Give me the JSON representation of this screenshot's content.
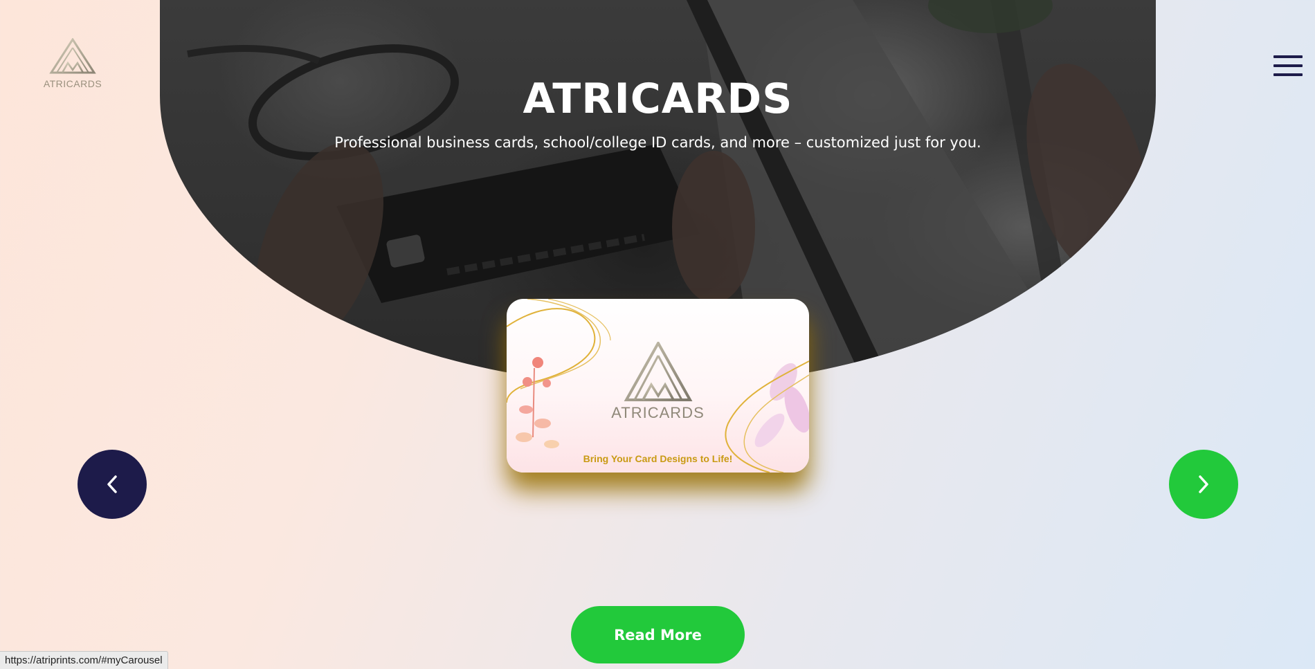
{
  "brand": {
    "logo_text": "ATRICARDS"
  },
  "hero": {
    "title": "ATRICARDS",
    "subtitle": "Professional business cards, school/college ID cards, and more – customized just for you."
  },
  "card": {
    "logo_text": "ATRICARDS",
    "tagline": "Bring Your Card Designs to Life!"
  },
  "carousel": {
    "prev_icon": "chevron-left-icon",
    "next_icon": "chevron-right-icon"
  },
  "cta": {
    "read_more_label": "Read More"
  },
  "status_bar": {
    "url": "https://atriprints.com/#myCarousel"
  },
  "colors": {
    "navy": "#1d1b4a",
    "green": "#22c93b",
    "gold": "#c99a12"
  }
}
